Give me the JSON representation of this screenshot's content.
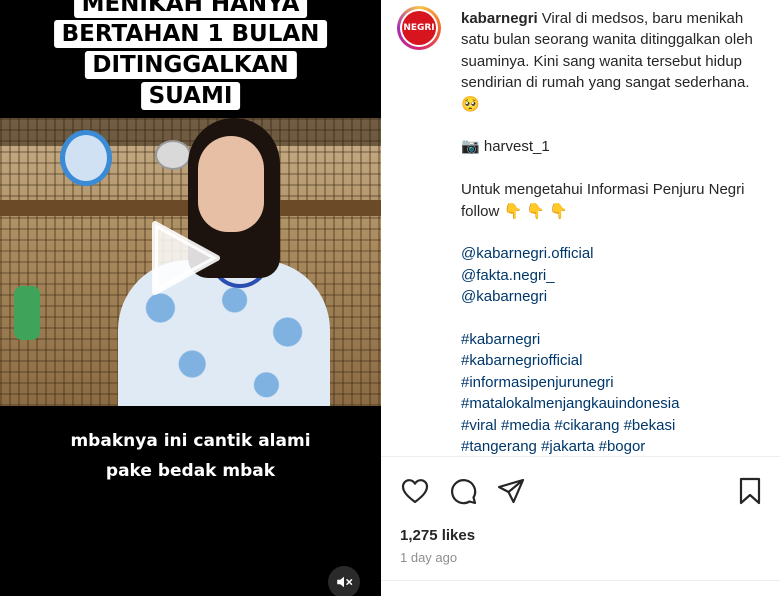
{
  "video": {
    "top_caption": [
      "MENIKAH HANYA",
      "BERTAHAN 1 BULAN",
      "DITINGGALKAN",
      "SUAMI"
    ],
    "bottom_caption": [
      "mbaknya ini cantik alami",
      "pake bedak mbak"
    ],
    "play_icon": "play-icon",
    "mute_icon": "muted-speaker-icon"
  },
  "post": {
    "username": "kabarnegri",
    "avatar_text": "NEGRI",
    "caption_first": "Viral di medsos, baru menikah satu bulan seorang wanita ditinggalkan oleh suaminya. Kini sang wanita tersebut hidup sendirian di rumah yang sangat sederhana.",
    "sad_emoji": "🥺",
    "camera_emoji": "📷",
    "credit": "harvest_1",
    "follow_line": "Untuk mengetahui Informasi Penjuru Negri follow",
    "pointing_emojis": "👇 👇 👇",
    "mentions": [
      "@kabarnegri.official",
      "@fakta.negri_",
      "@kabarnegri"
    ],
    "hashtags": [
      "#kabarnegri",
      "#kabarnegriofficial",
      "#informasipenjurunegri",
      "#matalokalmenjangkauindonesia",
      "#viral #media #cikarang #bekasi",
      "#tangerang #jakarta #bogor"
    ],
    "likes": "1,275 likes",
    "time": "1 day ago"
  },
  "colors": {
    "link": "#00376b",
    "text": "#262626",
    "muted": "#8e8e8e",
    "brand_red": "#d7151f"
  }
}
